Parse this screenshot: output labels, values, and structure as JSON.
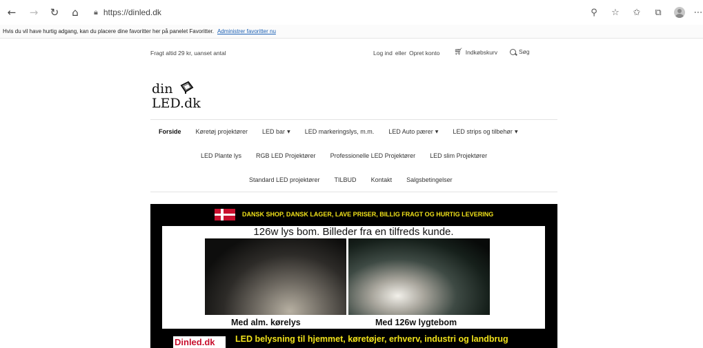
{
  "browser": {
    "url": "https://dinled.dk",
    "icons": [
      "back-icon",
      "forward-icon",
      "refresh-icon",
      "home-icon",
      "lock-icon",
      "zoom-icon",
      "add-favorite-icon",
      "favorites-icon",
      "collections-icon",
      "profile-icon",
      "more-icon"
    ]
  },
  "favorites_bar": {
    "message": "Hvis du vil have hurtig adgang, kan du placere dine favoritter her på panelet Favoritter.",
    "link": "Administrer favoritter nu"
  },
  "header": {
    "shipping": "Fragt altid 29 kr, uanset antal",
    "login": "Log ind",
    "or": "eller",
    "register": "Opret konto",
    "cart": "Indkøbskurv",
    "search": "Søg"
  },
  "logo": {
    "line1": "din",
    "line2": "LED.dk"
  },
  "menu": {
    "row1": [
      {
        "label": "Forside",
        "active": true,
        "dropdown": false
      },
      {
        "label": "Køretøj projektører",
        "active": false,
        "dropdown": false
      },
      {
        "label": "LED bar",
        "active": false,
        "dropdown": true
      },
      {
        "label": "LED markeringslys, m.m.",
        "active": false,
        "dropdown": false
      },
      {
        "label": "LED Auto pærer",
        "active": false,
        "dropdown": true
      },
      {
        "label": "LED strips og tilbehør",
        "active": false,
        "dropdown": true
      }
    ],
    "row2": [
      {
        "label": "LED Plante lys"
      },
      {
        "label": "RGB LED Projektører"
      },
      {
        "label": "Professionelle LED Projektører"
      },
      {
        "label": "LED slim Projektører"
      }
    ],
    "row3": [
      {
        "label": "Standard LED projektører"
      },
      {
        "label": "TILBUD"
      },
      {
        "label": "Kontakt"
      },
      {
        "label": "Salgsbetingelser"
      }
    ]
  },
  "banner": {
    "top_text": "DANSK SHOP, DANSK LAGER, LAVE PRISER, BILLIG FRAGT OG HURTIG LEVERING",
    "title": "126w lys bom. Billeder fra en tilfreds kunde.",
    "caption_left": "Med alm. kørelys",
    "caption_right": "Med 126w lygtebom",
    "logo_text": "Dinled.dk",
    "bottom_text": "LED belysning til hjemmet, køretøjer, erhverv, industri og landbrug",
    "colors": {
      "background": "#000000",
      "accent": "#f1e21a",
      "flag_red": "#c8102e"
    }
  }
}
